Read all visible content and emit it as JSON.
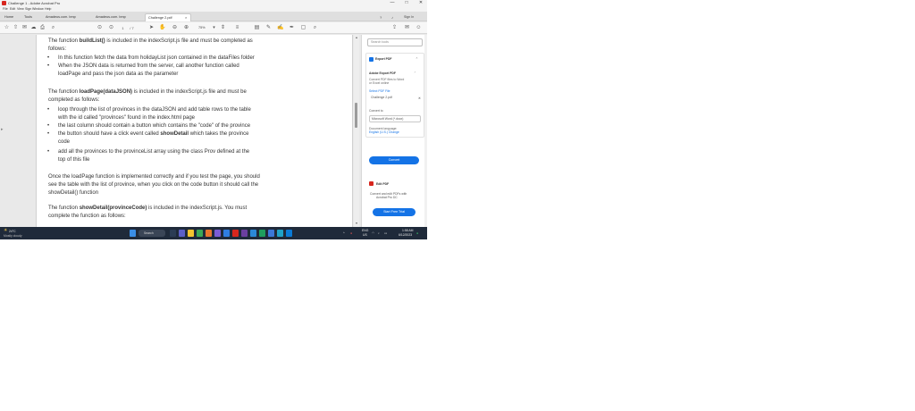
{
  "window": {
    "title": "Challenge 1 - Adobe Acrobat Pro",
    "controls": [
      "—",
      "□",
      "✕"
    ]
  },
  "menu": [
    "File",
    "Edit",
    "View",
    "Sign",
    "Window",
    "Help"
  ],
  "tabs": {
    "items": [
      {
        "label": "Home"
      },
      {
        "label": "Tools"
      },
      {
        "label": "Amadeus.com. bmp"
      },
      {
        "label": "Amadeus.com. bmp"
      },
      {
        "label": "Challenge 2.pdf",
        "active": true
      }
    ],
    "sign_in": "Sign In"
  },
  "toolbar": {
    "zoom": "75%"
  },
  "document": {
    "lines": [
      {
        "pre": "The function ",
        "bold": "buildList()",
        "post": " is included in the indexScript.js file and must be completed as"
      },
      {
        "pre": "follows:"
      },
      {
        "bullet": "•",
        "pre": "In this function fetch the data from holidayList json contained in the dataFiles folder"
      },
      {
        "bullet": "•",
        "pre": "When the JSON data is returned from the server, call another function called"
      },
      {
        "pre": "loadPage and pass the json data as the parameter"
      },
      {
        "pre": "The function ",
        "bold": "loadPage(dataJSON)",
        "post": " is included in the indexScript.js file and must be"
      },
      {
        "pre": "completed as follows:"
      },
      {
        "bullet": "•",
        "pre": "loop through the list of provinces in the dataJSON and add table rows to the table"
      },
      {
        "pre": "with the id called \"provinces\" found in the index.html page"
      },
      {
        "bullet": "•",
        "pre": "the last column should contain a button which contains the \"code\" of the province"
      },
      {
        "bullet": "•",
        "pre": "the button should have a click event called ",
        "bold": "showDetail",
        "post": " which takes the province"
      },
      {
        "pre": "code"
      },
      {
        "bullet": "•",
        "pre": "add all the provinces to the provinceList array using the class Prov defined at the"
      },
      {
        "pre": "top of this file"
      },
      {
        "pre": "Once the loadPage function is implemented correctly and if you test the page, you should"
      },
      {
        "pre": "see the table with the list of province, when you click on the code button it should call the"
      },
      {
        "pre": "showDetail() function"
      },
      {
        "pre": "The function ",
        "bold": "showDetail(provinceCode)",
        "post": " is included in the indexScript.js. You must"
      },
      {
        "pre": "complete the function as follows:"
      }
    ]
  },
  "side_panel": {
    "search_placeholder": "Search tools",
    "export_title": "Export PDF",
    "product": "Adobe Export PDF",
    "desc_line1": "Convert PDF files to Word",
    "desc_line2": "or Excel online",
    "select_label": "Select PDF File",
    "file_value": "Challenge 2.pdf",
    "convert_to": "Convert to",
    "format_value": "Microsoft Word (*.docx)",
    "lang_line1": "Document language:",
    "lang_line2": "English (U.S.) Change",
    "convert_button": "Convert",
    "create_title": "Edit PDF",
    "create_desc1": "Convert and edit PDFs with",
    "create_desc2": "Acrobat Pro DC",
    "trial_button": "Start Free Trial"
  },
  "taskbar": {
    "weather_temp": "24°C",
    "weather_desc": "Mostly cloudy",
    "search_label": "Search",
    "tray_lang_top": "ENG",
    "tray_lang_bottom": "US",
    "time": "1:58 AM",
    "date": "6/12/2023"
  },
  "colors": {
    "accent": "#1473e6",
    "acrobat_red": "#d7261e",
    "taskbar": "#1f2a3a"
  }
}
